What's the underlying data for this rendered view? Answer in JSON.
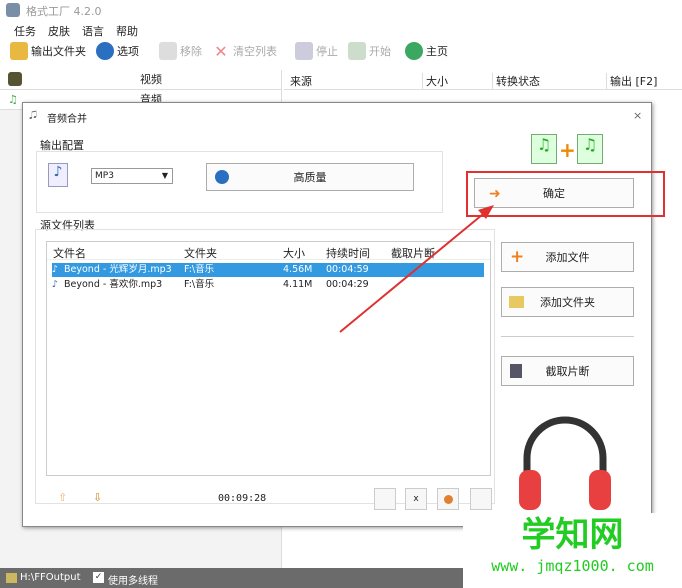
{
  "app": {
    "title": "格式工厂 4.2.0"
  },
  "menu": [
    "任务",
    "皮肤",
    "语言",
    "帮助"
  ],
  "toolbar": {
    "output_folder": "输出文件夹",
    "options": "选项",
    "remove": "移除",
    "clear_list": "清空列表",
    "stop": "停止",
    "start": "开始",
    "home": "主页"
  },
  "left_panel": {
    "video": "视频",
    "audio": "音频"
  },
  "task_list": {
    "columns": [
      "来源",
      "大小",
      "转换状态",
      "输出 [F2]"
    ]
  },
  "dialog": {
    "title": "音频合并",
    "output_config_label": "输出配置",
    "format": "MP3",
    "quality_label": "高质量",
    "ok_label": "确定",
    "source_list_label": "源文件列表",
    "columns": [
      "文件名",
      "文件夹",
      "大小",
      "持续时间",
      "截取片断"
    ],
    "files": [
      {
        "name": "Beyond - 光辉岁月.mp3",
        "folder": "F:\\音乐",
        "size": "4.56M",
        "duration": "00:04:59",
        "clip": "",
        "selected": true
      },
      {
        "name": "Beyond - 喜欢你.mp3",
        "folder": "F:\\音乐",
        "size": "4.11M",
        "duration": "00:04:29",
        "clip": "",
        "selected": false
      }
    ],
    "total_duration": "00:09:28",
    "add_file_label": "添加文件",
    "add_folder_label": "添加文件夹",
    "clip_label": "截取片断"
  },
  "status_bar": {
    "output_path": "H:\\FFOutput",
    "multithread_label": "使用多线程",
    "multithread_checked": true
  },
  "watermark": {
    "name": "学知网",
    "url": "www. jmqz1000. com"
  },
  "colors": {
    "selection": "#3399e0",
    "annotation_red": "#e03030",
    "watermark_green": "#22cc22"
  }
}
